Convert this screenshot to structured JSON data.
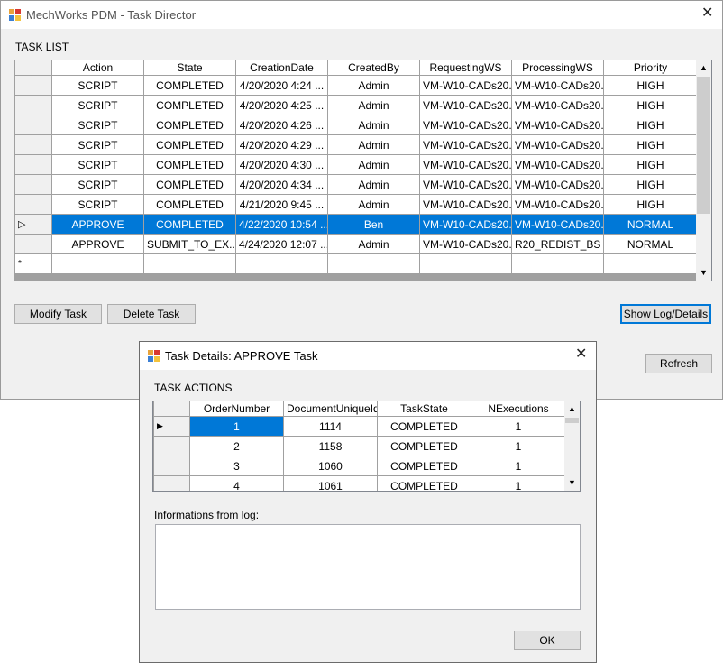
{
  "main_window": {
    "title": "MechWorks PDM - Task Director",
    "section_label": "TASK LIST",
    "columns": [
      "Action",
      "State",
      "CreationDate",
      "CreatedBy",
      "RequestingWS",
      "ProcessingWS",
      "Priority"
    ],
    "rows": [
      {
        "action": "SCRIPT",
        "state": "COMPLETED",
        "date": "4/20/2020 4:24 ...",
        "by": "Admin",
        "req": "VM-W10-CADs20...",
        "proc": "VM-W10-CADs20...",
        "priority": "HIGH"
      },
      {
        "action": "SCRIPT",
        "state": "COMPLETED",
        "date": "4/20/2020 4:25 ...",
        "by": "Admin",
        "req": "VM-W10-CADs20...",
        "proc": "VM-W10-CADs20...",
        "priority": "HIGH"
      },
      {
        "action": "SCRIPT",
        "state": "COMPLETED",
        "date": "4/20/2020 4:26 ...",
        "by": "Admin",
        "req": "VM-W10-CADs20...",
        "proc": "VM-W10-CADs20...",
        "priority": "HIGH"
      },
      {
        "action": "SCRIPT",
        "state": "COMPLETED",
        "date": "4/20/2020 4:29 ...",
        "by": "Admin",
        "req": "VM-W10-CADs20...",
        "proc": "VM-W10-CADs20...",
        "priority": "HIGH"
      },
      {
        "action": "SCRIPT",
        "state": "COMPLETED",
        "date": "4/20/2020 4:30 ...",
        "by": "Admin",
        "req": "VM-W10-CADs20...",
        "proc": "VM-W10-CADs20...",
        "priority": "HIGH"
      },
      {
        "action": "SCRIPT",
        "state": "COMPLETED",
        "date": "4/20/2020 4:34 ...",
        "by": "Admin",
        "req": "VM-W10-CADs20...",
        "proc": "VM-W10-CADs20...",
        "priority": "HIGH"
      },
      {
        "action": "SCRIPT",
        "state": "COMPLETED",
        "date": "4/21/2020 9:45 ...",
        "by": "Admin",
        "req": "VM-W10-CADs20...",
        "proc": "VM-W10-CADs20...",
        "priority": "HIGH"
      },
      {
        "action": "APPROVE",
        "state": "COMPLETED",
        "date": "4/22/2020 10:54 ...",
        "by": "Ben",
        "req": "VM-W10-CADs20...",
        "proc": "VM-W10-CADs20...",
        "priority": "NORMAL"
      },
      {
        "action": "APPROVE",
        "state": "SUBMIT_TO_EX...",
        "date": "4/24/2020 12:07 ...",
        "by": "Admin",
        "req": "VM-W10-CADs20...",
        "proc": "R20_REDIST_BS",
        "priority": "NORMAL"
      }
    ],
    "new_row_marker": "*",
    "selected_row_marker": "▷",
    "buttons": {
      "modify": "Modify Task",
      "delete": "Delete Task",
      "show_log": "Show Log/Details",
      "refresh": "Refresh"
    },
    "close_glyph": "✕"
  },
  "details_dialog": {
    "title": "Task Details: APPROVE Task",
    "section_label": "TASK ACTIONS",
    "columns": [
      "OrderNumber",
      "DocumentUniqueId",
      "TaskState",
      "NExecutions"
    ],
    "rows": [
      {
        "order": "1",
        "doc": "1114",
        "state": "COMPLETED",
        "n": "1"
      },
      {
        "order": "2",
        "doc": "1158",
        "state": "COMPLETED",
        "n": "1"
      },
      {
        "order": "3",
        "doc": "1060",
        "state": "COMPLETED",
        "n": "1"
      },
      {
        "order": "4",
        "doc": "1061",
        "state": "COMPLETED",
        "n": "1"
      }
    ],
    "current_row_marker": "▶",
    "log_label": "Informations from log:",
    "log_value": "",
    "ok_label": "OK",
    "close_glyph": "✕"
  },
  "colors": {
    "selection": "#0078d7",
    "window_bg": "#f0f0f0",
    "grid_line": "#a0a0a0"
  }
}
